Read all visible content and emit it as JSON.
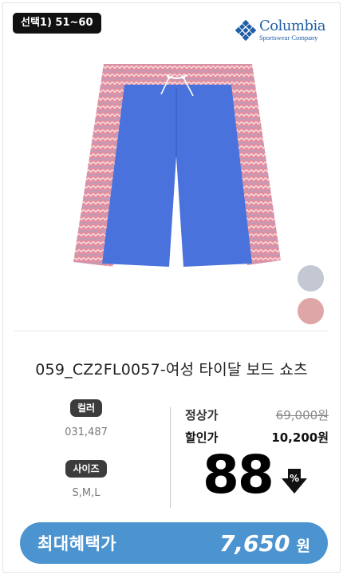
{
  "option_badge": "선택1) 51~60",
  "brand": {
    "name": "Columbia",
    "subtitle": "Sportswear Company",
    "color": "#1f5fa8"
  },
  "product": {
    "title": "059_CZ2FL0057-여성 타이달 보드 쇼츠",
    "image_icon": "board-shorts-image",
    "swatch_colors": [
      "#c3c8d3",
      "#dfa6a7"
    ]
  },
  "specs": {
    "color_label": "컬러",
    "color_value": "031,487",
    "size_label": "사이즈",
    "size_value": "S,M,L"
  },
  "pricing": {
    "regular_label": "정상가",
    "regular_price": "69,000원",
    "sale_label": "할인가",
    "sale_price": "10,200원",
    "discount_percent": "88",
    "discount_icon_text": "%"
  },
  "cta": {
    "label": "최대혜택가",
    "amount": "7,650",
    "unit": "원",
    "color": "#4b94d0"
  }
}
